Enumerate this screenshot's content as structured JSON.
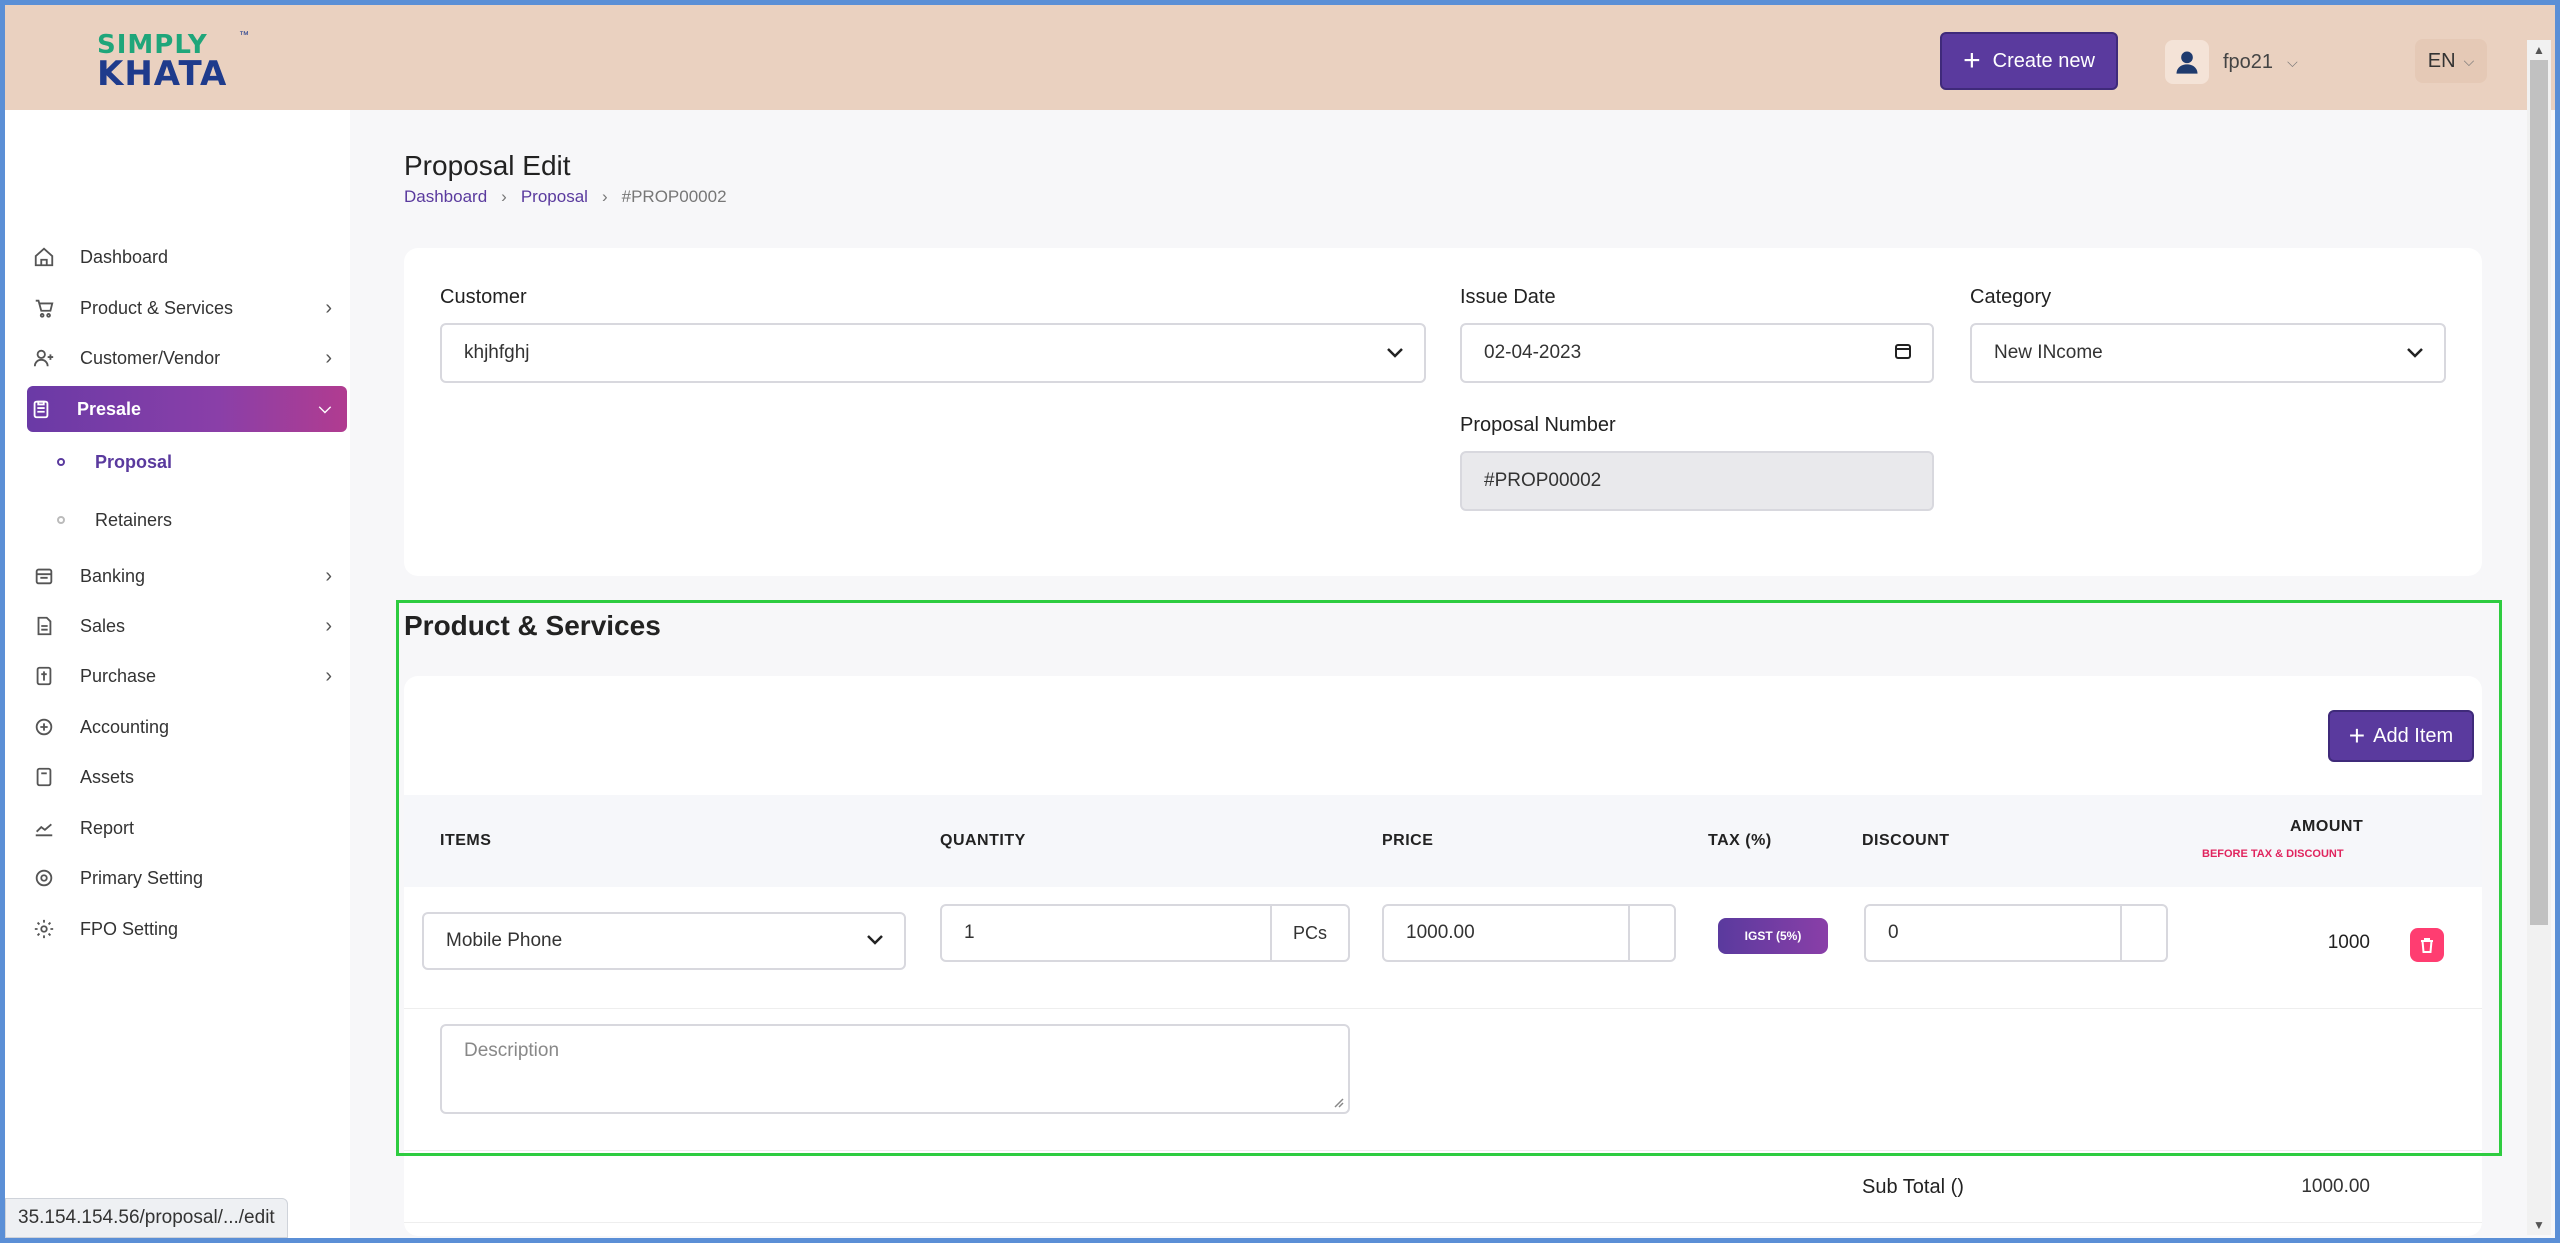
{
  "header": {
    "logo_line1": "SIMPLY",
    "logo_line2": "KHATA",
    "logo_tm": "™",
    "create_label": "Create new",
    "username": "fpo21",
    "language": "EN"
  },
  "sidebar": {
    "items": [
      {
        "label": "Dashboard",
        "icon": "home-icon"
      },
      {
        "label": "Product & Services",
        "icon": "cart-icon"
      },
      {
        "label": "Customer/Vendor",
        "icon": "user-add-icon"
      },
      {
        "label": "Presale",
        "icon": "clipboard-icon"
      },
      {
        "label": "Banking",
        "icon": "bank-icon"
      },
      {
        "label": "Sales",
        "icon": "sales-icon"
      },
      {
        "label": "Purchase",
        "icon": "purchase-icon"
      },
      {
        "label": "Accounting",
        "icon": "accounting-icon"
      },
      {
        "label": "Assets",
        "icon": "assets-icon"
      },
      {
        "label": "Report",
        "icon": "report-icon"
      },
      {
        "label": "Primary Setting",
        "icon": "primary-setting-icon"
      },
      {
        "label": "FPO Setting",
        "icon": "gear-icon"
      }
    ],
    "sub_items": [
      {
        "label": "Proposal"
      },
      {
        "label": "Retainers"
      }
    ]
  },
  "page": {
    "title": "Proposal Edit",
    "breadcrumb": [
      "Dashboard",
      "Proposal",
      "#PROP00002"
    ]
  },
  "form": {
    "customer_label": "Customer",
    "customer_value": "khjhfghj",
    "issue_date_label": "Issue Date",
    "issue_date_value": "02-04-2023",
    "category_label": "Category",
    "category_value": "New INcome",
    "proposal_number_label": "Proposal Number",
    "proposal_number_value": "#PROP00002"
  },
  "products": {
    "section_title": "Product & Services",
    "add_item_label": "Add Item",
    "columns": {
      "items": "ITEMS",
      "quantity": "QUANTITY",
      "price": "PRICE",
      "tax": "TAX (%)",
      "discount": "DISCOUNT",
      "amount": "AMOUNT",
      "amount_sub": "BEFORE TAX & DISCOUNT"
    },
    "row": {
      "item": "Mobile Phone",
      "quantity": "1",
      "unit": "PCs",
      "price": "1000.00",
      "tax_badge": "IGST (5%)",
      "discount": "0",
      "amount": "1000"
    },
    "description_placeholder": "Description",
    "subtotal_label": "Sub Total ()",
    "subtotal_value": "1000.00"
  },
  "status_url": "35.154.154.56/proposal/.../edit",
  "colors": {
    "header_bg": "#ead1c0",
    "primary": "#5a3a9e",
    "danger": "#ff3d71",
    "highlight": "#2ecc40"
  }
}
